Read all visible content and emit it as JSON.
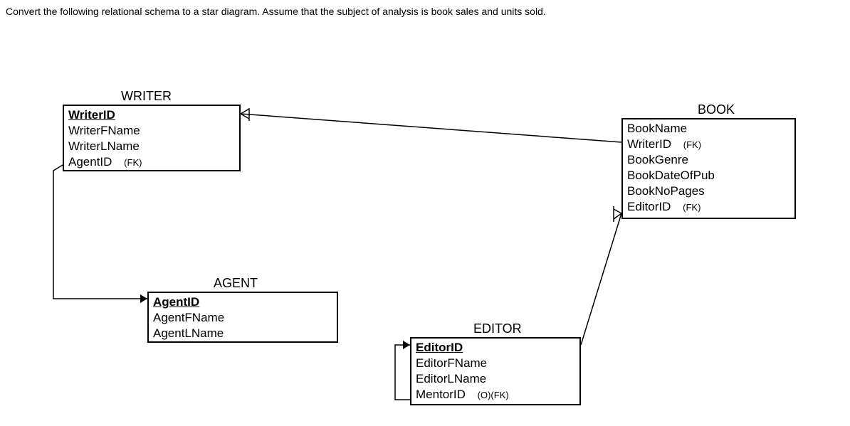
{
  "instruction": "Convert the following relational schema to a star diagram.  Assume that the subject of analysis is book sales and units sold.",
  "entities": {
    "writer": {
      "title": "WRITER",
      "pk": "WriterID",
      "attrs": {
        "fname": "WriterFName",
        "lname": "WriterLName",
        "agentid": "AgentID",
        "agentid_fk": "(FK)"
      }
    },
    "book": {
      "title": "BOOK",
      "attrs": {
        "bookname": "BookName",
        "writerid": "WriterID",
        "writerid_fk": "(FK)",
        "genre": "BookGenre",
        "dateofpub": "BookDateOfPub",
        "nopages": "BookNoPages",
        "editorid": "EditorID",
        "editorid_fk": "(FK)"
      }
    },
    "agent": {
      "title": "AGENT",
      "pk": "AgentID",
      "attrs": {
        "fname": "AgentFName",
        "lname": "AgentLName"
      }
    },
    "editor": {
      "title": "EDITOR",
      "pk": "EditorID",
      "attrs": {
        "fname": "EditorFName",
        "lname": "EditorLName",
        "mentorid": "MentorID",
        "mentorid_fk": "(O)(FK)"
      }
    }
  }
}
